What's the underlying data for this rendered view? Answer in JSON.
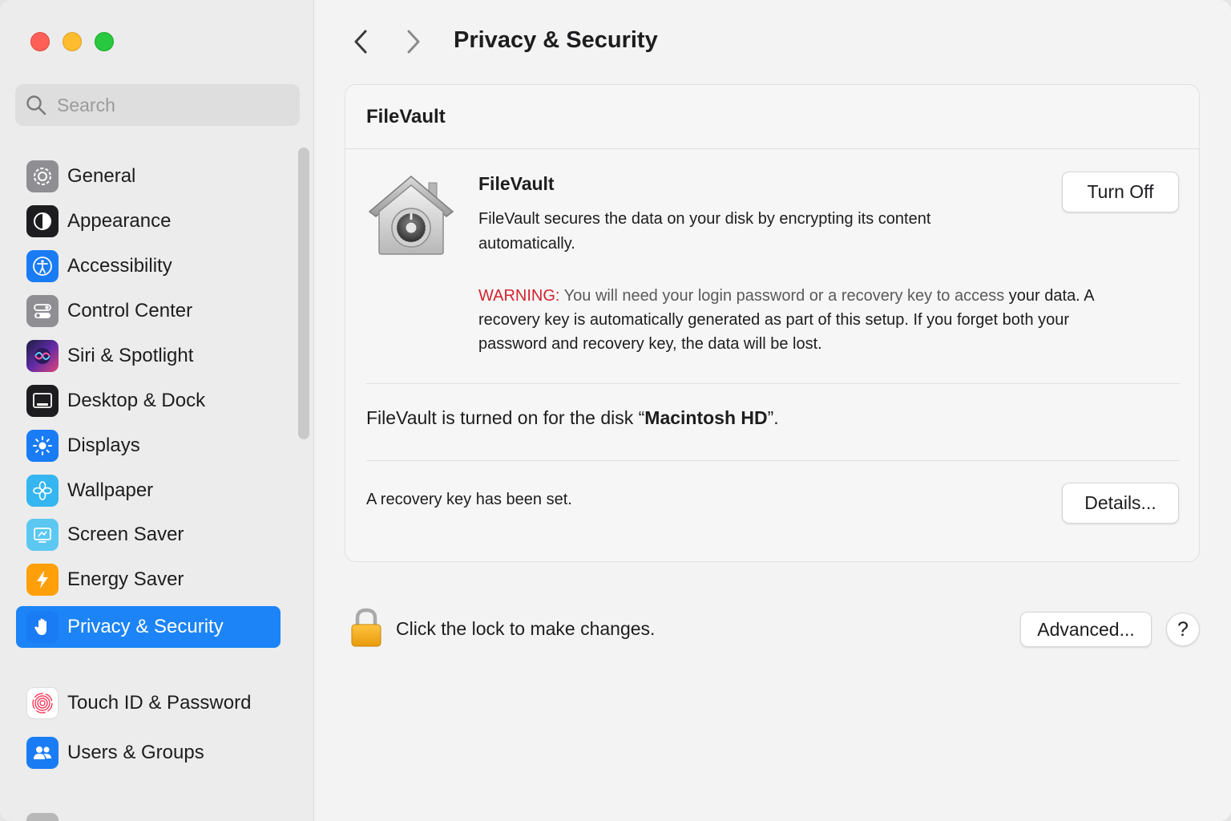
{
  "window": {
    "title": "Privacy & Security"
  },
  "sidebar": {
    "search": {
      "placeholder": "Search",
      "value": ""
    },
    "items": [
      {
        "label": "General",
        "icon": "gear-icon",
        "color": "#8e8e93"
      },
      {
        "label": "Appearance",
        "icon": "appearance-icon",
        "color": "#1d1d1f"
      },
      {
        "label": "Accessibility",
        "icon": "accessibility-icon",
        "color": "#1a7cf5"
      },
      {
        "label": "Control Center",
        "icon": "control-center-icon",
        "color": "#8e8e93"
      },
      {
        "label": "Siri & Spotlight",
        "icon": "siri-icon",
        "color": "#5e2ba6"
      },
      {
        "label": "Desktop & Dock",
        "icon": "desktop-dock-icon",
        "color": "#1d1d1f"
      },
      {
        "label": "Displays",
        "icon": "displays-icon",
        "color": "#1a7cf5"
      },
      {
        "label": "Wallpaper",
        "icon": "wallpaper-icon",
        "color": "#35b6f0"
      },
      {
        "label": "Screen Saver",
        "icon": "screen-saver-icon",
        "color": "#4fc3f7"
      },
      {
        "label": "Energy Saver",
        "icon": "energy-saver-icon",
        "color": "#ff9f0a"
      },
      {
        "label": "Privacy & Security",
        "icon": "hand-icon",
        "color": "#1a7cf5",
        "active": true
      },
      {
        "label": "Touch ID & Password",
        "icon": "fingerprint-icon",
        "color": "#ffffff"
      },
      {
        "label": "Users & Groups",
        "icon": "users-icon",
        "color": "#1a7cf5"
      }
    ]
  },
  "main": {
    "title": "Privacy & Security",
    "panel": {
      "header": "FileVault",
      "filevault_title": "FileVault",
      "description": "FileVault secures the data on your disk by encrypting its content automatically.",
      "warning_label": "WARNING:",
      "warning_text": " You will need your login password or a recovery key to access",
      "warning_rest": "your data. A recovery key is automatically generated as part of this setup. If you forget both your password and recovery key, the data will be lost.",
      "turn_off_label": "Turn Off",
      "disk_status_prefix": "FileVault is turned on for the disk “",
      "disk_name": "Macintosh HD",
      "disk_status_suffix": "”.",
      "recovery_text": "A recovery key has been set.",
      "details_label": "Details..."
    },
    "lock_text": "Click the lock to make changes.",
    "advanced_label": "Advanced...",
    "help_label": "?"
  }
}
